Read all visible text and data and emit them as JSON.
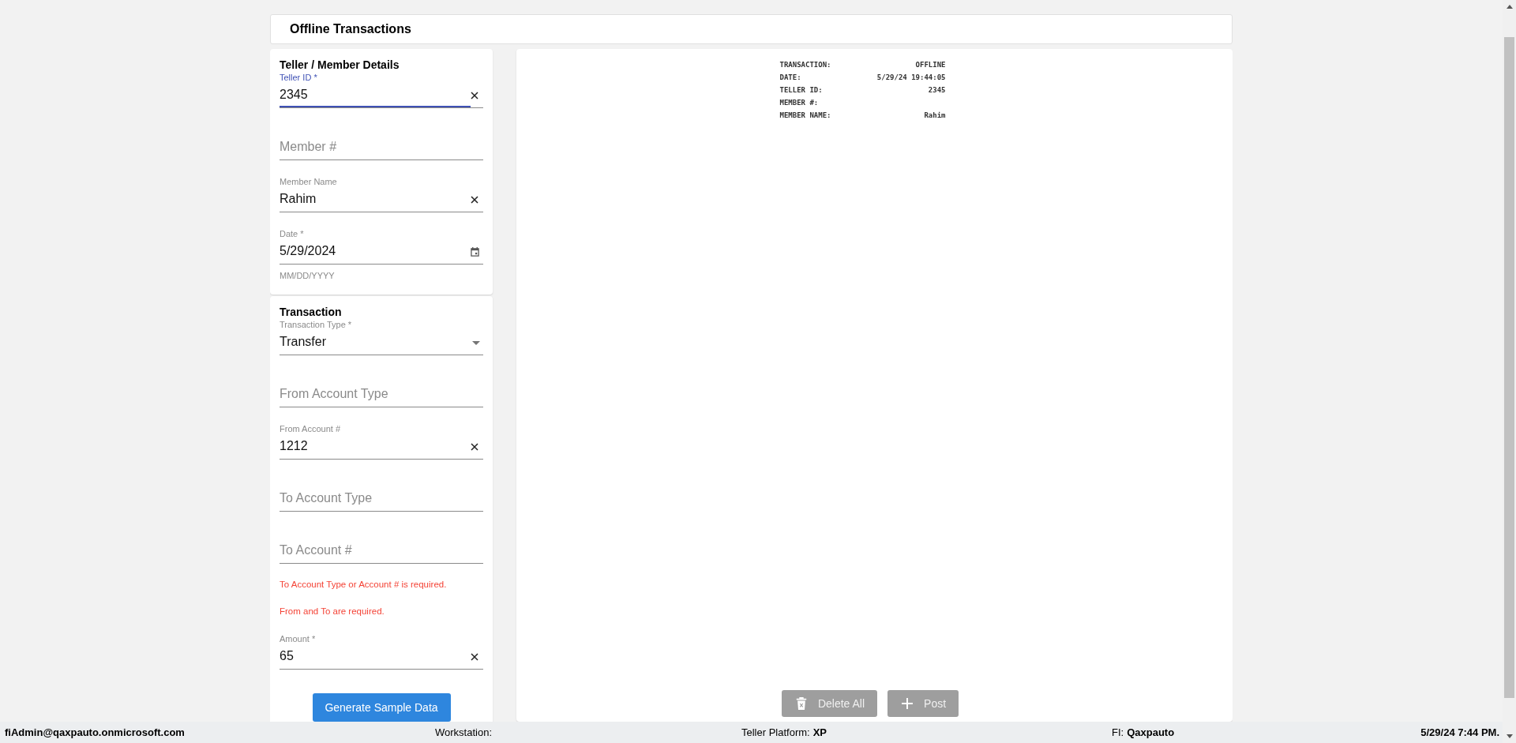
{
  "header": {
    "title": "Offline Transactions"
  },
  "sections": [
    {
      "title": "Teller / Member Details",
      "items": [
        {
          "kind": "text",
          "label": "Teller ID *",
          "value": "2345",
          "focused": true,
          "clearable": true
        },
        {
          "kind": "text",
          "placeholder": "Member #",
          "focused": false,
          "clearable": false
        },
        {
          "kind": "text",
          "label": "Member Name",
          "value": "Rahim",
          "focused": false,
          "clearable": true
        },
        {
          "kind": "date",
          "label": "Date *",
          "value": "5/29/2024",
          "hint": "MM/DD/YYYY",
          "focused": false
        }
      ]
    },
    {
      "title": "Transaction",
      "items": [
        {
          "kind": "select",
          "label": "Transaction Type *",
          "value": "Transfer",
          "focused": false
        },
        {
          "kind": "text",
          "placeholder": "From Account Type",
          "focused": false,
          "clearable": false
        },
        {
          "kind": "text",
          "label": "From Account #",
          "value": "1212",
          "focused": false,
          "clearable": true
        },
        {
          "kind": "text",
          "placeholder": "To Account Type",
          "focused": false,
          "clearable": false
        },
        {
          "kind": "text",
          "placeholder": "To Account #",
          "focused": false,
          "clearable": false
        },
        {
          "kind": "error",
          "text": "To Account Type or Account # is required."
        },
        {
          "kind": "error",
          "text": "From and To are required."
        },
        {
          "kind": "text",
          "label": "Amount *",
          "value": "65",
          "focused": false,
          "clearable": true
        }
      ],
      "button": "Generate Sample Data"
    }
  ],
  "receipt": [
    {
      "label": "TRANSACTION:",
      "value": "OFFLINE"
    },
    {
      "label": "DATE:",
      "value": "5/29/24 19:44:05"
    },
    {
      "label": "TELLER ID:",
      "value": "2345"
    },
    {
      "label": "MEMBER #:"
    },
    {
      "label": "MEMBER NAME:",
      "value": "Rahim"
    }
  ],
  "actions": [
    {
      "kind": "delete",
      "label": "Delete All",
      "disabled": true
    },
    {
      "kind": "add",
      "label": "Post",
      "disabled": true
    }
  ],
  "status_bar": [
    {
      "kind": "user",
      "value": "fiAdmin@qaxpauto.onmicrosoft.com"
    },
    {
      "kind": "info",
      "label": "Workstation:"
    },
    {
      "kind": "info",
      "label": "Teller Platform:",
      "value": "XP"
    },
    {
      "kind": "info",
      "label": "FI:",
      "value": "Qaxpauto"
    },
    {
      "kind": "time",
      "value": "5/29/24 7:44 PM."
    }
  ]
}
